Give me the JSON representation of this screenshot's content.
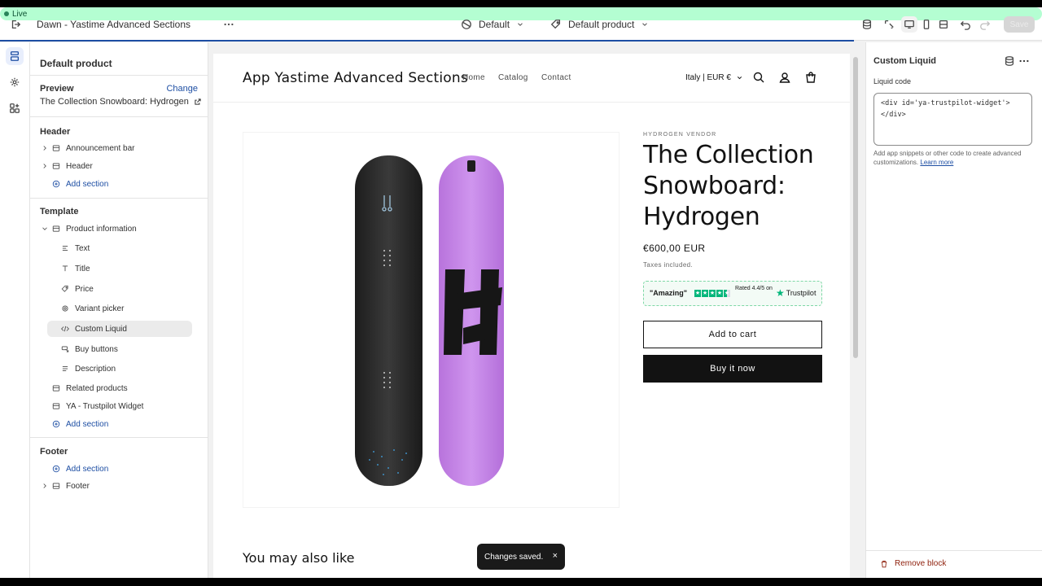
{
  "topbar": {
    "theme_name": "Dawn - Yastime Advanced Sections",
    "live_badge": "Live",
    "template_select": "Default",
    "product_select": "Default product",
    "save_label": "Save"
  },
  "sidebar": {
    "title": "Default product",
    "preview_label": "Preview",
    "change_link": "Change",
    "preview_value": "The Collection Snowboard: Hydrogen",
    "header_group": {
      "label": "Header",
      "items": [
        "Announcement bar",
        "Header"
      ],
      "add_section": "Add section"
    },
    "template_group": {
      "label": "Template",
      "section": "Product information",
      "blocks": [
        "Text",
        "Title",
        "Price",
        "Variant picker",
        "Custom Liquid",
        "Buy buttons",
        "Description"
      ],
      "selected_block": "Custom Liquid",
      "sections": [
        "Related products",
        "YA - Trustpilot Widget"
      ],
      "add_section": "Add section"
    },
    "footer_group": {
      "label": "Footer",
      "add_section": "Add section",
      "items": [
        "Footer"
      ]
    }
  },
  "preview": {
    "store_name": "App Yastime Advanced Sections",
    "nav": [
      "Home",
      "Catalog",
      "Contact"
    ],
    "currency": "Italy | EUR €",
    "vendor": "HYDROGEN VENDOR",
    "product_title": "The Collection Snowboard: Hydrogen",
    "price": "€600,00 EUR",
    "tax_note": "Taxes included.",
    "trustpilot": {
      "amazing": "\"Amazing\"",
      "rated": "Rated 4.4/5 on",
      "logo": "Trustpilot",
      "rating_value": 4.4,
      "rating_max": 5
    },
    "add_to_cart": "Add to cart",
    "buy_now": "Buy it now",
    "also_like": "You may also like"
  },
  "toast": {
    "message": "Changes saved.",
    "close": "×"
  },
  "right_panel": {
    "title": "Custom Liquid",
    "field_label": "Liquid code",
    "code_value": "<div id='ya-trustpilot-widget'>\n</div>",
    "help_text": "Add app snippets or other code to create advanced customizations.",
    "learn_more": "Learn more",
    "remove_block": "Remove block"
  },
  "colors": {
    "accent": "#1d4ea3",
    "live_bg": "#b4fed2",
    "trustpilot_green": "#00b67a",
    "board_black": "#2a2a2a",
    "board_purple": "#c88ae6",
    "danger": "#8e1f0b"
  }
}
